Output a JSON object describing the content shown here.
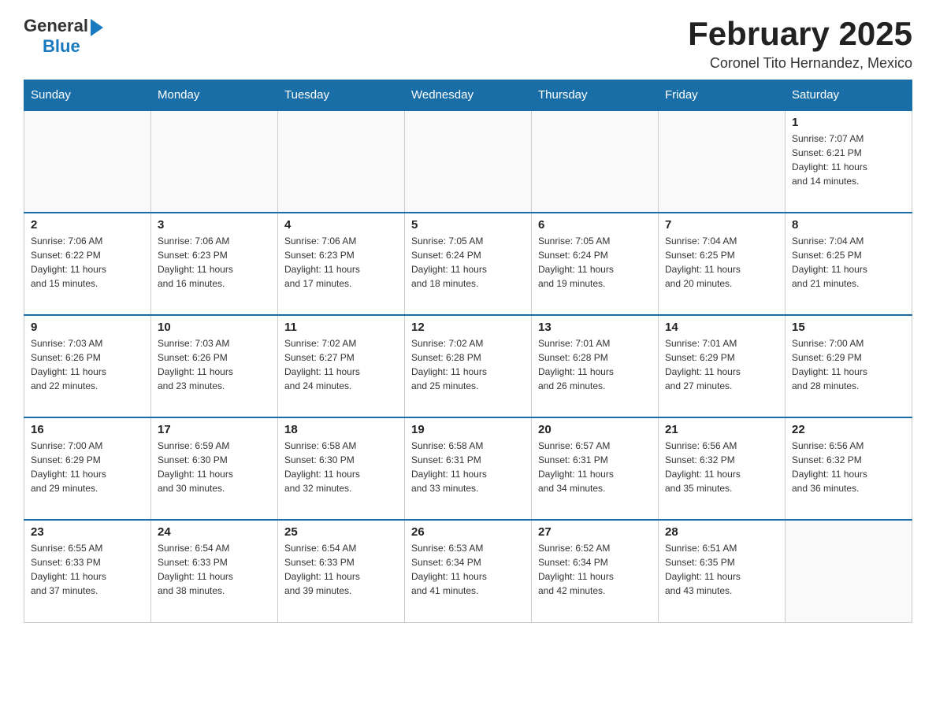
{
  "header": {
    "logo": {
      "general": "General",
      "blue": "Blue"
    },
    "title": "February 2025",
    "subtitle": "Coronel Tito Hernandez, Mexico"
  },
  "weekdays": [
    "Sunday",
    "Monday",
    "Tuesday",
    "Wednesday",
    "Thursday",
    "Friday",
    "Saturday"
  ],
  "weeks": [
    [
      {
        "day": "",
        "info": ""
      },
      {
        "day": "",
        "info": ""
      },
      {
        "day": "",
        "info": ""
      },
      {
        "day": "",
        "info": ""
      },
      {
        "day": "",
        "info": ""
      },
      {
        "day": "",
        "info": ""
      },
      {
        "day": "1",
        "info": "Sunrise: 7:07 AM\nSunset: 6:21 PM\nDaylight: 11 hours\nand 14 minutes."
      }
    ],
    [
      {
        "day": "2",
        "info": "Sunrise: 7:06 AM\nSunset: 6:22 PM\nDaylight: 11 hours\nand 15 minutes."
      },
      {
        "day": "3",
        "info": "Sunrise: 7:06 AM\nSunset: 6:23 PM\nDaylight: 11 hours\nand 16 minutes."
      },
      {
        "day": "4",
        "info": "Sunrise: 7:06 AM\nSunset: 6:23 PM\nDaylight: 11 hours\nand 17 minutes."
      },
      {
        "day": "5",
        "info": "Sunrise: 7:05 AM\nSunset: 6:24 PM\nDaylight: 11 hours\nand 18 minutes."
      },
      {
        "day": "6",
        "info": "Sunrise: 7:05 AM\nSunset: 6:24 PM\nDaylight: 11 hours\nand 19 minutes."
      },
      {
        "day": "7",
        "info": "Sunrise: 7:04 AM\nSunset: 6:25 PM\nDaylight: 11 hours\nand 20 minutes."
      },
      {
        "day": "8",
        "info": "Sunrise: 7:04 AM\nSunset: 6:25 PM\nDaylight: 11 hours\nand 21 minutes."
      }
    ],
    [
      {
        "day": "9",
        "info": "Sunrise: 7:03 AM\nSunset: 6:26 PM\nDaylight: 11 hours\nand 22 minutes."
      },
      {
        "day": "10",
        "info": "Sunrise: 7:03 AM\nSunset: 6:26 PM\nDaylight: 11 hours\nand 23 minutes."
      },
      {
        "day": "11",
        "info": "Sunrise: 7:02 AM\nSunset: 6:27 PM\nDaylight: 11 hours\nand 24 minutes."
      },
      {
        "day": "12",
        "info": "Sunrise: 7:02 AM\nSunset: 6:28 PM\nDaylight: 11 hours\nand 25 minutes."
      },
      {
        "day": "13",
        "info": "Sunrise: 7:01 AM\nSunset: 6:28 PM\nDaylight: 11 hours\nand 26 minutes."
      },
      {
        "day": "14",
        "info": "Sunrise: 7:01 AM\nSunset: 6:29 PM\nDaylight: 11 hours\nand 27 minutes."
      },
      {
        "day": "15",
        "info": "Sunrise: 7:00 AM\nSunset: 6:29 PM\nDaylight: 11 hours\nand 28 minutes."
      }
    ],
    [
      {
        "day": "16",
        "info": "Sunrise: 7:00 AM\nSunset: 6:29 PM\nDaylight: 11 hours\nand 29 minutes."
      },
      {
        "day": "17",
        "info": "Sunrise: 6:59 AM\nSunset: 6:30 PM\nDaylight: 11 hours\nand 30 minutes."
      },
      {
        "day": "18",
        "info": "Sunrise: 6:58 AM\nSunset: 6:30 PM\nDaylight: 11 hours\nand 32 minutes."
      },
      {
        "day": "19",
        "info": "Sunrise: 6:58 AM\nSunset: 6:31 PM\nDaylight: 11 hours\nand 33 minutes."
      },
      {
        "day": "20",
        "info": "Sunrise: 6:57 AM\nSunset: 6:31 PM\nDaylight: 11 hours\nand 34 minutes."
      },
      {
        "day": "21",
        "info": "Sunrise: 6:56 AM\nSunset: 6:32 PM\nDaylight: 11 hours\nand 35 minutes."
      },
      {
        "day": "22",
        "info": "Sunrise: 6:56 AM\nSunset: 6:32 PM\nDaylight: 11 hours\nand 36 minutes."
      }
    ],
    [
      {
        "day": "23",
        "info": "Sunrise: 6:55 AM\nSunset: 6:33 PM\nDaylight: 11 hours\nand 37 minutes."
      },
      {
        "day": "24",
        "info": "Sunrise: 6:54 AM\nSunset: 6:33 PM\nDaylight: 11 hours\nand 38 minutes."
      },
      {
        "day": "25",
        "info": "Sunrise: 6:54 AM\nSunset: 6:33 PM\nDaylight: 11 hours\nand 39 minutes."
      },
      {
        "day": "26",
        "info": "Sunrise: 6:53 AM\nSunset: 6:34 PM\nDaylight: 11 hours\nand 41 minutes."
      },
      {
        "day": "27",
        "info": "Sunrise: 6:52 AM\nSunset: 6:34 PM\nDaylight: 11 hours\nand 42 minutes."
      },
      {
        "day": "28",
        "info": "Sunrise: 6:51 AM\nSunset: 6:35 PM\nDaylight: 11 hours\nand 43 minutes."
      },
      {
        "day": "",
        "info": ""
      }
    ]
  ]
}
